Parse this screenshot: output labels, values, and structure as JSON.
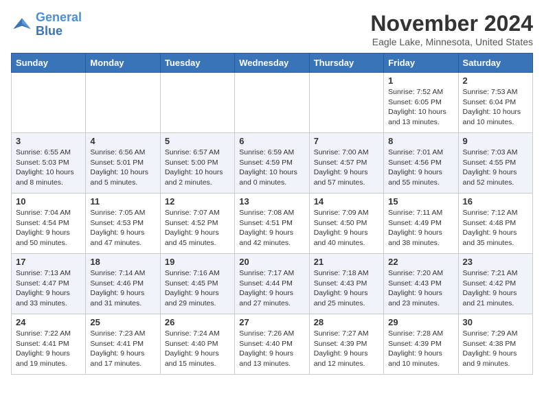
{
  "header": {
    "logo_line1": "General",
    "logo_line2": "Blue",
    "month_title": "November 2024",
    "location": "Eagle Lake, Minnesota, United States"
  },
  "days_of_week": [
    "Sunday",
    "Monday",
    "Tuesday",
    "Wednesday",
    "Thursday",
    "Friday",
    "Saturday"
  ],
  "weeks": [
    [
      {
        "day": "",
        "info": ""
      },
      {
        "day": "",
        "info": ""
      },
      {
        "day": "",
        "info": ""
      },
      {
        "day": "",
        "info": ""
      },
      {
        "day": "",
        "info": ""
      },
      {
        "day": "1",
        "info": "Sunrise: 7:52 AM\nSunset: 6:05 PM\nDaylight: 10 hours and 13 minutes."
      },
      {
        "day": "2",
        "info": "Sunrise: 7:53 AM\nSunset: 6:04 PM\nDaylight: 10 hours and 10 minutes."
      }
    ],
    [
      {
        "day": "3",
        "info": "Sunrise: 6:55 AM\nSunset: 5:03 PM\nDaylight: 10 hours and 8 minutes."
      },
      {
        "day": "4",
        "info": "Sunrise: 6:56 AM\nSunset: 5:01 PM\nDaylight: 10 hours and 5 minutes."
      },
      {
        "day": "5",
        "info": "Sunrise: 6:57 AM\nSunset: 5:00 PM\nDaylight: 10 hours and 2 minutes."
      },
      {
        "day": "6",
        "info": "Sunrise: 6:59 AM\nSunset: 4:59 PM\nDaylight: 10 hours and 0 minutes."
      },
      {
        "day": "7",
        "info": "Sunrise: 7:00 AM\nSunset: 4:57 PM\nDaylight: 9 hours and 57 minutes."
      },
      {
        "day": "8",
        "info": "Sunrise: 7:01 AM\nSunset: 4:56 PM\nDaylight: 9 hours and 55 minutes."
      },
      {
        "day": "9",
        "info": "Sunrise: 7:03 AM\nSunset: 4:55 PM\nDaylight: 9 hours and 52 minutes."
      }
    ],
    [
      {
        "day": "10",
        "info": "Sunrise: 7:04 AM\nSunset: 4:54 PM\nDaylight: 9 hours and 50 minutes."
      },
      {
        "day": "11",
        "info": "Sunrise: 7:05 AM\nSunset: 4:53 PM\nDaylight: 9 hours and 47 minutes."
      },
      {
        "day": "12",
        "info": "Sunrise: 7:07 AM\nSunset: 4:52 PM\nDaylight: 9 hours and 45 minutes."
      },
      {
        "day": "13",
        "info": "Sunrise: 7:08 AM\nSunset: 4:51 PM\nDaylight: 9 hours and 42 minutes."
      },
      {
        "day": "14",
        "info": "Sunrise: 7:09 AM\nSunset: 4:50 PM\nDaylight: 9 hours and 40 minutes."
      },
      {
        "day": "15",
        "info": "Sunrise: 7:11 AM\nSunset: 4:49 PM\nDaylight: 9 hours and 38 minutes."
      },
      {
        "day": "16",
        "info": "Sunrise: 7:12 AM\nSunset: 4:48 PM\nDaylight: 9 hours and 35 minutes."
      }
    ],
    [
      {
        "day": "17",
        "info": "Sunrise: 7:13 AM\nSunset: 4:47 PM\nDaylight: 9 hours and 33 minutes."
      },
      {
        "day": "18",
        "info": "Sunrise: 7:14 AM\nSunset: 4:46 PM\nDaylight: 9 hours and 31 minutes."
      },
      {
        "day": "19",
        "info": "Sunrise: 7:16 AM\nSunset: 4:45 PM\nDaylight: 9 hours and 29 minutes."
      },
      {
        "day": "20",
        "info": "Sunrise: 7:17 AM\nSunset: 4:44 PM\nDaylight: 9 hours and 27 minutes."
      },
      {
        "day": "21",
        "info": "Sunrise: 7:18 AM\nSunset: 4:43 PM\nDaylight: 9 hours and 25 minutes."
      },
      {
        "day": "22",
        "info": "Sunrise: 7:20 AM\nSunset: 4:43 PM\nDaylight: 9 hours and 23 minutes."
      },
      {
        "day": "23",
        "info": "Sunrise: 7:21 AM\nSunset: 4:42 PM\nDaylight: 9 hours and 21 minutes."
      }
    ],
    [
      {
        "day": "24",
        "info": "Sunrise: 7:22 AM\nSunset: 4:41 PM\nDaylight: 9 hours and 19 minutes."
      },
      {
        "day": "25",
        "info": "Sunrise: 7:23 AM\nSunset: 4:41 PM\nDaylight: 9 hours and 17 minutes."
      },
      {
        "day": "26",
        "info": "Sunrise: 7:24 AM\nSunset: 4:40 PM\nDaylight: 9 hours and 15 minutes."
      },
      {
        "day": "27",
        "info": "Sunrise: 7:26 AM\nSunset: 4:40 PM\nDaylight: 9 hours and 13 minutes."
      },
      {
        "day": "28",
        "info": "Sunrise: 7:27 AM\nSunset: 4:39 PM\nDaylight: 9 hours and 12 minutes."
      },
      {
        "day": "29",
        "info": "Sunrise: 7:28 AM\nSunset: 4:39 PM\nDaylight: 9 hours and 10 minutes."
      },
      {
        "day": "30",
        "info": "Sunrise: 7:29 AM\nSunset: 4:38 PM\nDaylight: 9 hours and 9 minutes."
      }
    ]
  ]
}
